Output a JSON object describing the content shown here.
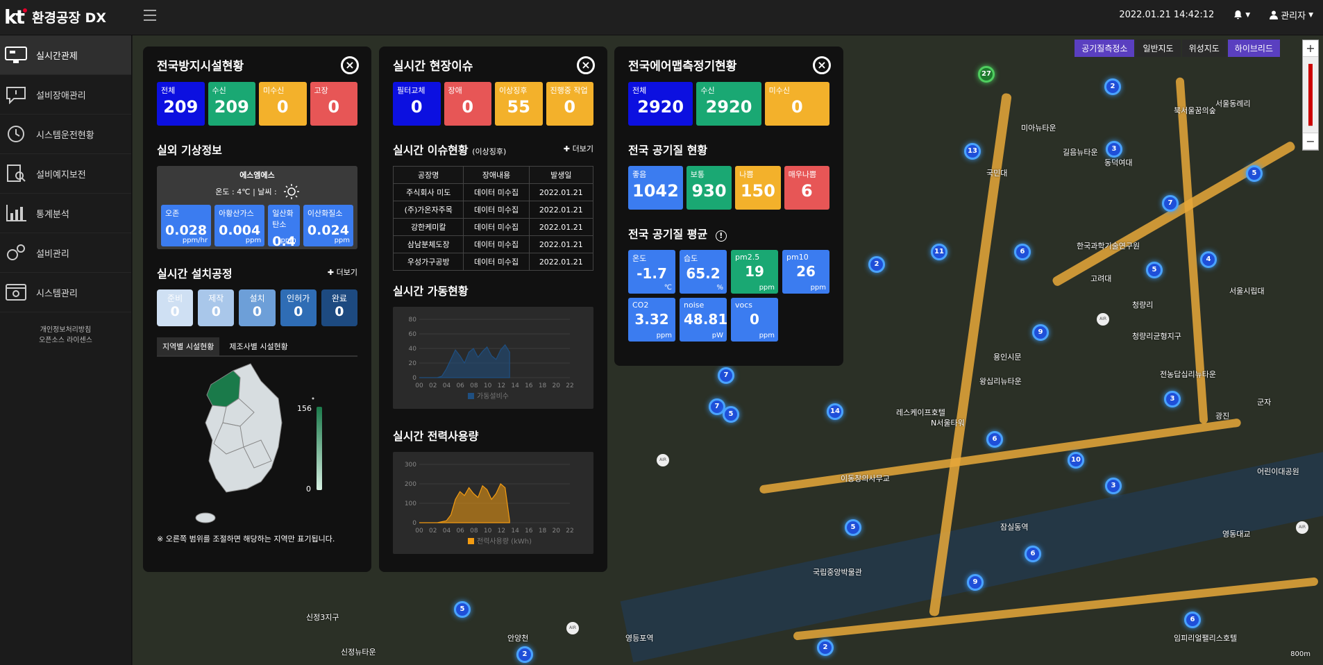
{
  "header": {
    "brand": "kt",
    "app_title": "환경공장 DX",
    "datetime": "2022.01.21 14:42:12",
    "user": "관리자"
  },
  "sidebar": {
    "items": [
      {
        "label": "실시간관제",
        "icon": "monitor-icon"
      },
      {
        "label": "설비장애관리",
        "icon": "chat-alert-icon"
      },
      {
        "label": "시스템운전현황",
        "icon": "history-icon"
      },
      {
        "label": "설비예지보전",
        "icon": "document-search-icon"
      },
      {
        "label": "통계분석",
        "icon": "bar-chart-icon"
      },
      {
        "label": "설비관리",
        "icon": "gears-icon"
      },
      {
        "label": "시스템관리",
        "icon": "settings-window-icon"
      }
    ],
    "privacy": "개인정보처리방침",
    "license": "오픈소스 라이센스"
  },
  "map": {
    "types": [
      "공기질측정소",
      "일반지도",
      "위성지도",
      "하이브리드"
    ],
    "zoom_in": "+",
    "zoom_out": "−",
    "scale": "800m"
  },
  "panel1": {
    "title": "전국방지시설현황",
    "kpis": [
      {
        "label": "전체",
        "value": "209",
        "color": "#0c10e0"
      },
      {
        "label": "수신",
        "value": "209",
        "color": "#1aa873"
      },
      {
        "label": "미수신",
        "value": "0",
        "color": "#f3b12b"
      },
      {
        "label": "고장",
        "value": "0",
        "color": "#e75656"
      }
    ],
    "weather_title": "실외 기상정보",
    "station": "에스엠에스",
    "temp_text": "온도 : 4℃ | 날씨 :",
    "weather_items": [
      {
        "label": "오존",
        "value": "0.028",
        "unit": "ppm/hr"
      },
      {
        "label": "아황산가스",
        "value": "0.004",
        "unit": "ppm"
      },
      {
        "label": "일산화탄소",
        "value": "0.4",
        "unit": "ppm"
      },
      {
        "label": "이산화질소",
        "value": "0.024",
        "unit": "ppm"
      }
    ],
    "install_title": "실시간 설치공정",
    "more": "더보기",
    "stages": [
      {
        "label": "준비",
        "value": "0",
        "color": "#cfe0f3"
      },
      {
        "label": "제작",
        "value": "0",
        "color": "#a9c7ea"
      },
      {
        "label": "설치",
        "value": "0",
        "color": "#6d9fd8"
      },
      {
        "label": "인허가",
        "value": "0",
        "color": "#2f6db5"
      },
      {
        "label": "완료",
        "value": "0",
        "color": "#1d4a80"
      }
    ],
    "tabs": [
      "지역별 시설현황",
      "제조사별 시설현황"
    ],
    "legend_max": "156",
    "legend_min": "0",
    "footnote": "※ 오른쪽 범위를 조절하면 해당하는 지역만 표기됩니다."
  },
  "panel2": {
    "title": "실시간 현장이슈",
    "kpis": [
      {
        "label": "필터교체",
        "value": "0",
        "color": "#0c10e0"
      },
      {
        "label": "장애",
        "value": "0",
        "color": "#e75656"
      },
      {
        "label": "이상징후",
        "value": "55",
        "color": "#f3b12b"
      },
      {
        "label": "진행중 작업",
        "value": "0",
        "color": "#f3b12b"
      }
    ],
    "issue_title": "실시간 이슈현황",
    "issue_sub": "(이상징후)",
    "more": "더보기",
    "columns": [
      "공장명",
      "장애내용",
      "발생일"
    ],
    "rows": [
      [
        "주식회사 미도",
        "데이터 미수집",
        "2022.01.21"
      ],
      [
        "(주)가온자주목",
        "데이터 미수집",
        "2022.01.21"
      ],
      [
        "강한케미칼",
        "데이터 미수집",
        "2022.01.21"
      ],
      [
        "삼남분체도장",
        "데이터 미수집",
        "2022.01.21"
      ],
      [
        "우성가구공방",
        "데이터 미수집",
        "2022.01.21"
      ]
    ],
    "ops_title": "실시간 가동현황",
    "power_title": "실시간 전력사용량"
  },
  "panel3": {
    "title": "전국에어맵측정기현황",
    "kpis": [
      {
        "label": "전체",
        "value": "2920",
        "color": "#0c10e0"
      },
      {
        "label": "수신",
        "value": "2920",
        "color": "#1aa873"
      },
      {
        "label": "미수신",
        "value": "0",
        "color": "#f3b12b"
      }
    ],
    "aq_title": "전국 공기질 현황",
    "aq": [
      {
        "label": "좋음",
        "value": "1042",
        "color": "#3b7cf0"
      },
      {
        "label": "보통",
        "value": "930",
        "color": "#1aa873"
      },
      {
        "label": "나쁨",
        "value": "150",
        "color": "#f3b12b"
      },
      {
        "label": "매우나쁨",
        "value": "6",
        "color": "#e75656"
      }
    ],
    "avg_title": "전국 공기질 평균",
    "avg": [
      {
        "label": "온도",
        "value": "-1.7",
        "unit": "℃",
        "color": "#3b7cf0"
      },
      {
        "label": "습도",
        "value": "65.2",
        "unit": "%",
        "color": "#3b7cf0"
      },
      {
        "label": "pm2.5",
        "value": "19",
        "unit": "ppm",
        "color": "#1aa873"
      },
      {
        "label": "pm10",
        "value": "26",
        "unit": "ppm",
        "color": "#3b7cf0"
      },
      {
        "label": "CO2",
        "value": "3.32",
        "unit": "ppm",
        "color": "#3b7cf0"
      },
      {
        "label": "noise",
        "value": "48.81",
        "unit": "pW",
        "color": "#3b7cf0"
      },
      {
        "label": "vocs",
        "value": "0",
        "unit": "ppm",
        "color": "#3b7cf0"
      }
    ]
  },
  "chart_data": [
    {
      "type": "area",
      "title": "실시간 가동현황",
      "x": [
        "00",
        "02",
        "04",
        "06",
        "08",
        "10",
        "12",
        "14",
        "16",
        "18",
        "20",
        "22"
      ],
      "ylim": [
        0,
        80
      ],
      "yticks": [
        0,
        20,
        40,
        60,
        80
      ],
      "series": [
        {
          "name": "가동설비수",
          "color": "#1f4f80",
          "values": [
            0,
            0,
            0,
            0,
            0,
            2,
            12,
            25,
            38,
            30,
            20,
            35,
            40,
            28,
            36,
            42,
            30,
            25,
            38,
            45,
            35
          ]
        }
      ]
    },
    {
      "type": "area",
      "title": "실시간 전력사용량",
      "x": [
        "00",
        "02",
        "04",
        "06",
        "08",
        "10",
        "12",
        "14",
        "16",
        "18",
        "20",
        "22"
      ],
      "ylim": [
        0,
        300
      ],
      "yticks": [
        0,
        100,
        200,
        300
      ],
      "series": [
        {
          "name": "전력사용량 (kWh)",
          "color": "#f39c12",
          "values": [
            0,
            0,
            0,
            0,
            0,
            5,
            10,
            40,
            120,
            160,
            140,
            180,
            150,
            130,
            190,
            170,
            120,
            150,
            200,
            180,
            10
          ]
        }
      ]
    }
  ]
}
